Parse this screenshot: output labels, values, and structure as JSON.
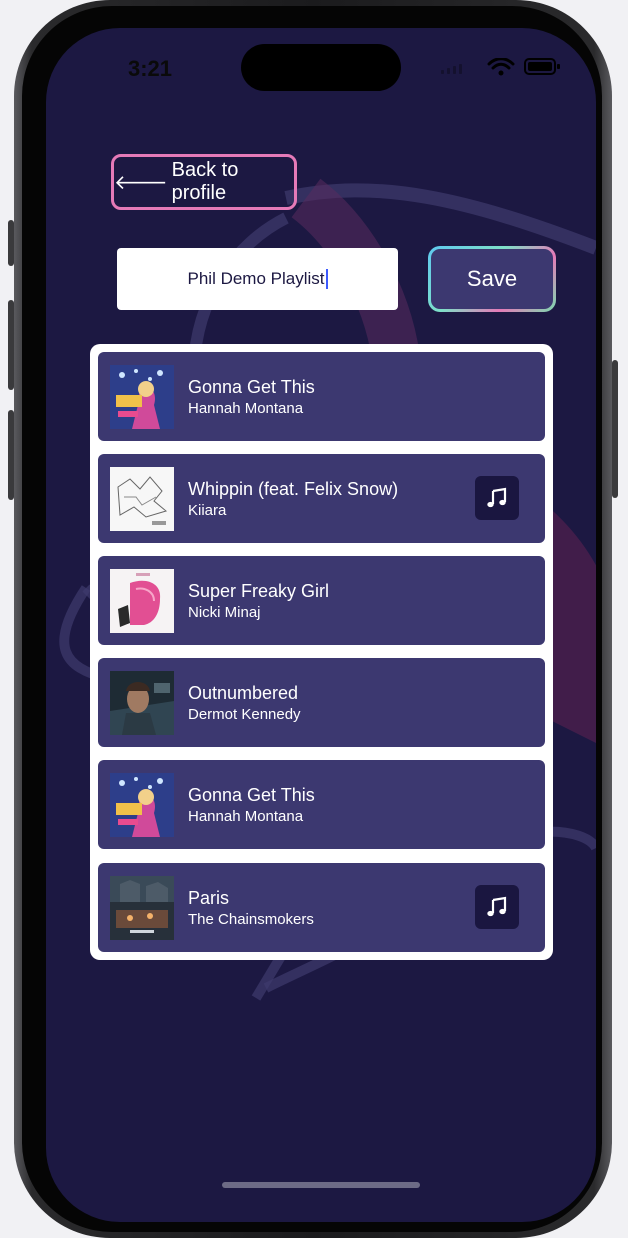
{
  "status_bar": {
    "time": "3:21"
  },
  "header": {
    "back_label": "Back to profile",
    "back_icon": "arrow-left-icon"
  },
  "playlist_editor": {
    "name_value": "Phil Demo Playlist",
    "save_label": "Save"
  },
  "tracks": [
    {
      "title": "Gonna Get This",
      "artist": "Hannah Montana",
      "cover": "hannah-montana-cover",
      "has_preview": false
    },
    {
      "title": "Whippin (feat. Felix Snow)",
      "artist": "Kiiara",
      "cover": "kiiara-cover",
      "has_preview": true
    },
    {
      "title": "Super Freaky Girl",
      "artist": "Nicki Minaj",
      "cover": "nicki-minaj-cover",
      "has_preview": false
    },
    {
      "title": "Outnumbered",
      "artist": "Dermot Kennedy",
      "cover": "dermot-kennedy-cover",
      "has_preview": false
    },
    {
      "title": "Gonna Get This",
      "artist": "Hannah Montana",
      "cover": "hannah-montana-cover",
      "has_preview": false
    },
    {
      "title": "Paris",
      "artist": "The Chainsmokers",
      "cover": "chainsmokers-cover",
      "has_preview": true
    }
  ],
  "colors": {
    "background": "#1c1842",
    "card": "#3c3870",
    "accent_pink": "#e57ab8",
    "accent_teal": "#5ec8f0",
    "note_button": "#1a1640"
  }
}
